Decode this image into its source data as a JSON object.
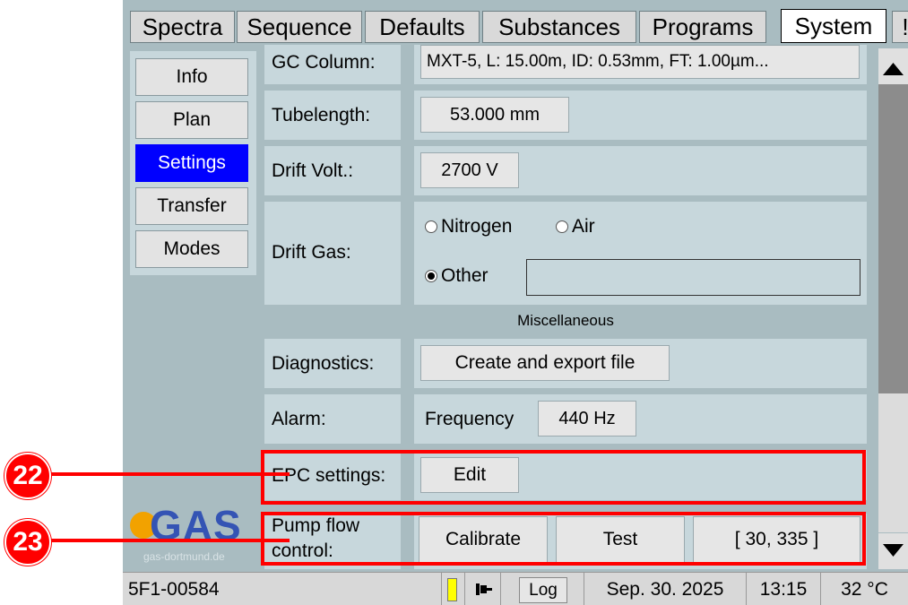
{
  "tabs": [
    "Spectra",
    "Sequence",
    "Defaults",
    "Substances",
    "Programs",
    "System",
    "!"
  ],
  "active_tab": "System",
  "side_menu": [
    "Info",
    "Plan",
    "Settings",
    "Transfer",
    "Modes"
  ],
  "active_side": "Settings",
  "rows": {
    "gc_column": {
      "label": "GC Column:",
      "value": "MXT-5, L: 15.00m, ID: 0.53mm, FT: 1.00µm..."
    },
    "tubelength": {
      "label": "Tubelength:",
      "value": "53.000 mm"
    },
    "drift_volt": {
      "label": "Drift Volt.:",
      "value": "2700 V"
    },
    "drift_gas": {
      "label": "Drift Gas:",
      "options": [
        "Nitrogen",
        "Air",
        "Other"
      ],
      "selected": "Other",
      "other_value": ""
    },
    "section": "Miscellaneous",
    "diagnostics": {
      "label": "Diagnostics:",
      "button": "Create and export file"
    },
    "alarm": {
      "label": "Alarm:",
      "freq_label": "Frequency",
      "freq_value": "440 Hz"
    },
    "epc": {
      "label": "EPC settings:",
      "button": "Edit"
    },
    "pump": {
      "label_line1": "Pump flow",
      "label_line2": "control:",
      "calibrate": "Calibrate",
      "test": "Test",
      "value": "[ 30, 335 ]"
    }
  },
  "logo": {
    "text": "GAS",
    "url": "gas-dortmund.de"
  },
  "status": {
    "device": "5F1-00584",
    "log": "Log",
    "date": "Sep. 30. 2025",
    "time": "13:15",
    "temp": "32 °C"
  },
  "callouts": [
    "22",
    "23"
  ],
  "colors": {
    "active": "#0000ff",
    "highlight": "#ff0000",
    "background": "#a9bcc1",
    "cell": "#c7d7dc"
  }
}
